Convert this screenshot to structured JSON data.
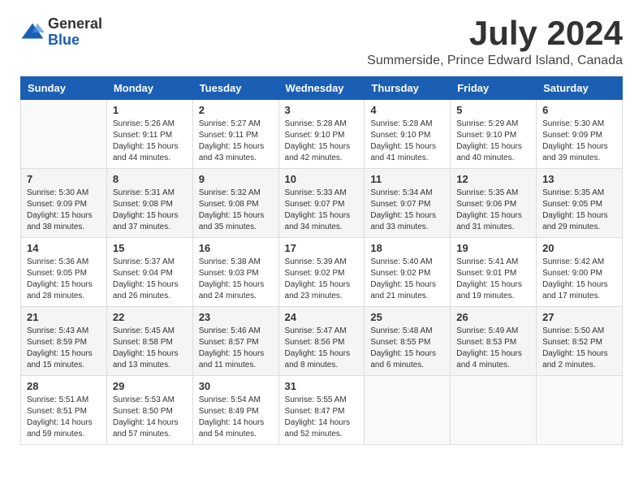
{
  "logo": {
    "general": "General",
    "blue": "Blue"
  },
  "title": "July 2024",
  "subtitle": "Summerside, Prince Edward Island, Canada",
  "days_of_week": [
    "Sunday",
    "Monday",
    "Tuesday",
    "Wednesday",
    "Thursday",
    "Friday",
    "Saturday"
  ],
  "weeks": [
    [
      {
        "day": "",
        "content": ""
      },
      {
        "day": "1",
        "content": "Sunrise: 5:26 AM\nSunset: 9:11 PM\nDaylight: 15 hours\nand 44 minutes."
      },
      {
        "day": "2",
        "content": "Sunrise: 5:27 AM\nSunset: 9:11 PM\nDaylight: 15 hours\nand 43 minutes."
      },
      {
        "day": "3",
        "content": "Sunrise: 5:28 AM\nSunset: 9:10 PM\nDaylight: 15 hours\nand 42 minutes."
      },
      {
        "day": "4",
        "content": "Sunrise: 5:28 AM\nSunset: 9:10 PM\nDaylight: 15 hours\nand 41 minutes."
      },
      {
        "day": "5",
        "content": "Sunrise: 5:29 AM\nSunset: 9:10 PM\nDaylight: 15 hours\nand 40 minutes."
      },
      {
        "day": "6",
        "content": "Sunrise: 5:30 AM\nSunset: 9:09 PM\nDaylight: 15 hours\nand 39 minutes."
      }
    ],
    [
      {
        "day": "7",
        "content": "Sunrise: 5:30 AM\nSunset: 9:09 PM\nDaylight: 15 hours\nand 38 minutes."
      },
      {
        "day": "8",
        "content": "Sunrise: 5:31 AM\nSunset: 9:08 PM\nDaylight: 15 hours\nand 37 minutes."
      },
      {
        "day": "9",
        "content": "Sunrise: 5:32 AM\nSunset: 9:08 PM\nDaylight: 15 hours\nand 35 minutes."
      },
      {
        "day": "10",
        "content": "Sunrise: 5:33 AM\nSunset: 9:07 PM\nDaylight: 15 hours\nand 34 minutes."
      },
      {
        "day": "11",
        "content": "Sunrise: 5:34 AM\nSunset: 9:07 PM\nDaylight: 15 hours\nand 33 minutes."
      },
      {
        "day": "12",
        "content": "Sunrise: 5:35 AM\nSunset: 9:06 PM\nDaylight: 15 hours\nand 31 minutes."
      },
      {
        "day": "13",
        "content": "Sunrise: 5:35 AM\nSunset: 9:05 PM\nDaylight: 15 hours\nand 29 minutes."
      }
    ],
    [
      {
        "day": "14",
        "content": "Sunrise: 5:36 AM\nSunset: 9:05 PM\nDaylight: 15 hours\nand 28 minutes."
      },
      {
        "day": "15",
        "content": "Sunrise: 5:37 AM\nSunset: 9:04 PM\nDaylight: 15 hours\nand 26 minutes."
      },
      {
        "day": "16",
        "content": "Sunrise: 5:38 AM\nSunset: 9:03 PM\nDaylight: 15 hours\nand 24 minutes."
      },
      {
        "day": "17",
        "content": "Sunrise: 5:39 AM\nSunset: 9:02 PM\nDaylight: 15 hours\nand 23 minutes."
      },
      {
        "day": "18",
        "content": "Sunrise: 5:40 AM\nSunset: 9:02 PM\nDaylight: 15 hours\nand 21 minutes."
      },
      {
        "day": "19",
        "content": "Sunrise: 5:41 AM\nSunset: 9:01 PM\nDaylight: 15 hours\nand 19 minutes."
      },
      {
        "day": "20",
        "content": "Sunrise: 5:42 AM\nSunset: 9:00 PM\nDaylight: 15 hours\nand 17 minutes."
      }
    ],
    [
      {
        "day": "21",
        "content": "Sunrise: 5:43 AM\nSunset: 8:59 PM\nDaylight: 15 hours\nand 15 minutes."
      },
      {
        "day": "22",
        "content": "Sunrise: 5:45 AM\nSunset: 8:58 PM\nDaylight: 15 hours\nand 13 minutes."
      },
      {
        "day": "23",
        "content": "Sunrise: 5:46 AM\nSunset: 8:57 PM\nDaylight: 15 hours\nand 11 minutes."
      },
      {
        "day": "24",
        "content": "Sunrise: 5:47 AM\nSunset: 8:56 PM\nDaylight: 15 hours\nand 8 minutes."
      },
      {
        "day": "25",
        "content": "Sunrise: 5:48 AM\nSunset: 8:55 PM\nDaylight: 15 hours\nand 6 minutes."
      },
      {
        "day": "26",
        "content": "Sunrise: 5:49 AM\nSunset: 8:53 PM\nDaylight: 15 hours\nand 4 minutes."
      },
      {
        "day": "27",
        "content": "Sunrise: 5:50 AM\nSunset: 8:52 PM\nDaylight: 15 hours\nand 2 minutes."
      }
    ],
    [
      {
        "day": "28",
        "content": "Sunrise: 5:51 AM\nSunset: 8:51 PM\nDaylight: 14 hours\nand 59 minutes."
      },
      {
        "day": "29",
        "content": "Sunrise: 5:53 AM\nSunset: 8:50 PM\nDaylight: 14 hours\nand 57 minutes."
      },
      {
        "day": "30",
        "content": "Sunrise: 5:54 AM\nSunset: 8:49 PM\nDaylight: 14 hours\nand 54 minutes."
      },
      {
        "day": "31",
        "content": "Sunrise: 5:55 AM\nSunset: 8:47 PM\nDaylight: 14 hours\nand 52 minutes."
      },
      {
        "day": "",
        "content": ""
      },
      {
        "day": "",
        "content": ""
      },
      {
        "day": "",
        "content": ""
      }
    ]
  ]
}
